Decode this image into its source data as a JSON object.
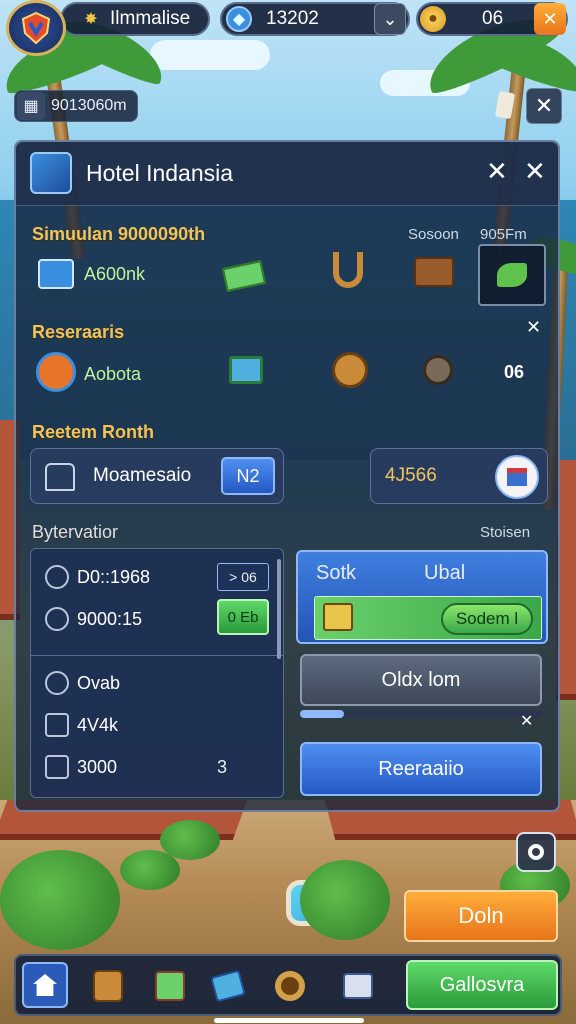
{
  "topbar": {
    "player_name": "Ilmmalise",
    "currency1": "13202",
    "currency2": "06"
  },
  "sub_status": "9013060m",
  "panel": {
    "title": "Hotel Indansia",
    "section1": {
      "title": "Simuulan 9000090th",
      "right_a": "Sosoon",
      "right_b": "905Fm",
      "item_label": "A600nk"
    },
    "section2": {
      "title": "Reseraaris",
      "item_label": "Aobota",
      "value": "06"
    },
    "section3": {
      "title": "Reetem Ronth",
      "left_label": "Moamesaio",
      "left_badge": "N2",
      "right_value": "4J566"
    },
    "section4": {
      "title": "Bytervatior",
      "right": "Stoisen",
      "stats": [
        {
          "label": "D0::1968",
          "badge": "> 06"
        },
        {
          "label": "9000:15",
          "badge": "0 Eb"
        },
        {
          "label": "Ovab"
        },
        {
          "label": "4V4k"
        },
        {
          "label": "3000",
          "extra": "3"
        }
      ],
      "card": {
        "left": "Sotk",
        "right": "Ubal",
        "action": "Sodem l"
      },
      "button_mid": "Oldx lom",
      "button_blue": "Reeraaiio"
    }
  },
  "cta_orange": "Doln",
  "cta_green": "Gallosvra"
}
